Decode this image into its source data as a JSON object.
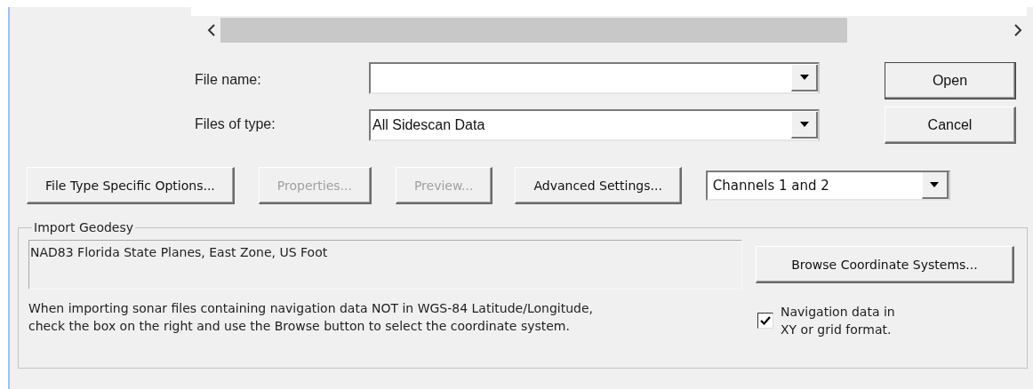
{
  "file_fields": [
    {
      "label": "File name:",
      "button": {
        "label": "Open",
        "default": true
      }
    },
    {
      "label": "Files of type:",
      "value": "All Sidescan Data",
      "button": {
        "label": "Cancel",
        "default": false
      }
    }
  ],
  "option_buttons": [
    {
      "label": "File Type Specific Options...",
      "disabled": false
    },
    {
      "label": "Properties...",
      "disabled": true
    },
    {
      "label": "Preview...",
      "disabled": true
    },
    {
      "label": "Advanced Settings...",
      "disabled": false
    }
  ],
  "channel_select": {
    "value": "Channels 1 and 2"
  },
  "import_geodesy": {
    "title": "Import Geodesy",
    "coordinate_system": "NAD83 Florida State Planes, East Zone, US Foot",
    "browse_button": "Browse Coordinate Systems...",
    "note": "When importing sonar files containing navigation data NOT in WGS-84 Latitude/Longitude,\ncheck the box on the right and use the Browse button to select the coordinate system.",
    "checkbox": {
      "label": "Navigation data in\nXY or grid format.",
      "checked": true
    }
  }
}
